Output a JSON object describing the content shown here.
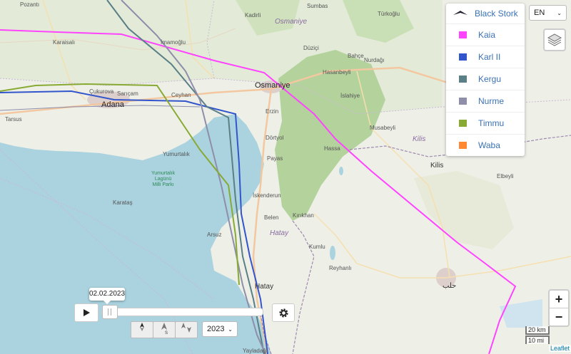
{
  "legend": {
    "title": "Black Stork",
    "items": [
      {
        "label": "Kaia",
        "color": "#ff44ff"
      },
      {
        "label": "Karl II",
        "color": "#3355cc"
      },
      {
        "label": "Kergu",
        "color": "#5a7f86"
      },
      {
        "label": "Nurme",
        "color": "#8e8eaa"
      },
      {
        "label": "Timmu",
        "color": "#88aa33"
      },
      {
        "label": "Waba",
        "color": "#ff8833"
      }
    ]
  },
  "language": {
    "selected": "EN"
  },
  "player": {
    "date": "02.02.2023",
    "year": "2023"
  },
  "direction_buttons": {
    "north_south": "N / S",
    "south": "S",
    "north": "N / S"
  },
  "scale": {
    "km": "20 km",
    "mi": "10 mi"
  },
  "attribution": "Leaflet",
  "zoom": {
    "in": "+",
    "out": "−"
  },
  "places": {
    "pozanti": "Pozantı",
    "karaisali": "Karaisalı",
    "imamoglu": "İmamoğlu",
    "kadirli": "Kadirli",
    "sumbas": "Sumbas",
    "osmaniye_region": "Osmaniye",
    "duzici": "Düziçi",
    "bahce": "Bahçe",
    "turkoglu": "Türkoğlu",
    "nurdagi": "Nurdağı",
    "hasanbeyli": "Hasanbeyli",
    "islahiye": "İslahiye",
    "kukurova": "Çukurova",
    "saricam": "Sarıçam",
    "adana": "Adana",
    "ceyhan": "Ceyhan",
    "osmaniye": "Osmaniye",
    "erzin": "Erzin",
    "tarsus": "Tarsus",
    "dortyol": "Dörtyol",
    "musabeyli": "Musabeyli",
    "kilis_small": "Kilis",
    "kilis": "Kilis",
    "elbeyli": "Elbeyli",
    "payas": "Payas",
    "yumurtalik": "Yumurtalık",
    "hassa": "Hassa",
    "yumurtalik_park": "Yumurtalık\nLagünü\nMilli Parkı",
    "iskenderun": "İskenderun",
    "karatas": "Karataş",
    "belen": "Belen",
    "kirikhan": "Kırıkhan",
    "arsuz": "Arsuz",
    "hatay_region": "Hatay",
    "kumlu": "Kumlu",
    "reyhanli": "Reyhanlı",
    "hatay": "Hatay",
    "yayladagi": "Yayladağı",
    "aleppo_small": "حلب"
  }
}
